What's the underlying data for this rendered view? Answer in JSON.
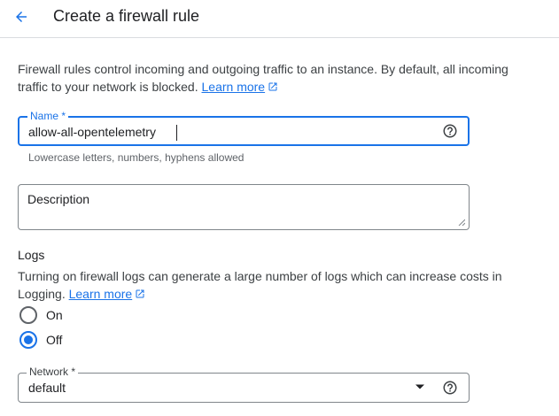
{
  "header": {
    "title": "Create a firewall rule"
  },
  "intro": {
    "text": "Firewall rules control incoming and outgoing traffic to an instance. By default, all incoming traffic to your network is blocked. ",
    "link_label": "Learn more"
  },
  "name_field": {
    "label": "Name *",
    "value": "allow-all-opentelemetry",
    "hint": "Lowercase letters, numbers, hyphens allowed"
  },
  "description_field": {
    "placeholder": "Description",
    "value": ""
  },
  "logs": {
    "heading": "Logs",
    "text": "Turning on firewall logs can generate a large number of logs which can increase costs in Logging. ",
    "link_label": "Learn more",
    "options": [
      {
        "label": "On",
        "selected": false
      },
      {
        "label": "Off",
        "selected": true
      }
    ]
  },
  "network_field": {
    "label": "Network *",
    "value": "default"
  },
  "colors": {
    "accent": "#1a73e8",
    "spellcheck": "#d93025"
  }
}
